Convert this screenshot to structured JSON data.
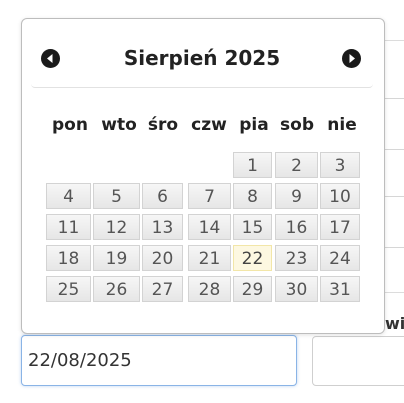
{
  "datepicker": {
    "title": "Sierpień 2025",
    "prev_icon": "chevron-left-circle-icon",
    "next_icon": "chevron-right-circle-icon",
    "weekdays": [
      "pon",
      "wto",
      "śro",
      "czw",
      "pia",
      "sob",
      "nie"
    ],
    "weeks": [
      [
        "",
        "",
        "",
        "",
        "1",
        "2",
        "3"
      ],
      [
        "4",
        "5",
        "6",
        "7",
        "8",
        "9",
        "10"
      ],
      [
        "11",
        "12",
        "13",
        "14",
        "15",
        "16",
        "17"
      ],
      [
        "18",
        "19",
        "20",
        "21",
        "22",
        "23",
        "24"
      ],
      [
        "25",
        "26",
        "27",
        "28",
        "29",
        "30",
        "31"
      ]
    ],
    "selected_day": "22",
    "highlight_color": "#fdf8e1"
  },
  "form": {
    "date_value": "22/08/2025",
    "partial_label": "wi"
  }
}
